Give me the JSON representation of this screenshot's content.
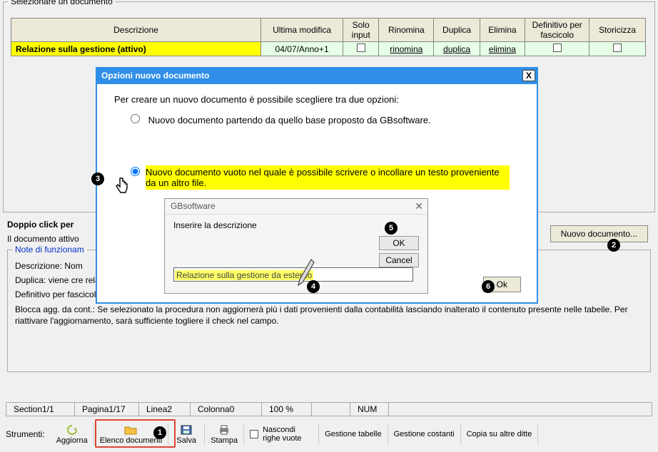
{
  "fieldset_title": "Selezionare un documento",
  "table": {
    "headers": [
      "Descrizione",
      "Ultima modifica",
      "Solo input",
      "Rinomina",
      "Duplica",
      "Elimina",
      "Definitivo per fascicolo",
      "Storicizza"
    ],
    "row": {
      "descrizione": "Relazione sulla gestione (attivo)",
      "ultima_modifica": "04/07/Anno+1",
      "rinomina": "rinomina",
      "duplica": "duplica",
      "elimina": "elimina"
    }
  },
  "below": {
    "line1": "Doppio click per ",
    "line2": "Il documento attivo"
  },
  "new_doc_btn": "Nuovo documento...",
  "notes": {
    "legend": "Note di funzionam",
    "p1": "Descrizione: Nom",
    "p2": "Duplica: viene cre relative ai conti pe",
    "p3": "Definitivo per fascicolo: Selezionare il documento che si ritiene definitivo e che verrà inserito nel fascicolo per la creazione del PDF/A.",
    "p4": "Blocca agg. da cont.: Se selezionato la procedura non aggiornerà più i dati provenienti dalla contabilità lasciando inalterato il contenuto presente nelle tabelle. Per riattivare l'aggiornamento, sarà sufficiente togliere il check nel campo."
  },
  "dlg1": {
    "title": "Opzioni nuovo documento",
    "intro": "Per creare un nuovo documento è possibile scegliere tra due opzioni:",
    "opt1": "Nuovo documento partendo da quello base proposto da GBsoftware.",
    "opt2": "Nuovo documento vuoto nel quale è possibile scrivere o incollare un testo proveniente da un altro file.",
    "ok": "Ok"
  },
  "dlg2": {
    "title": "GBsoftware",
    "label": "Inserire la descrizione",
    "value": "Relazione sulla gestione da esterno",
    "ok": "OK",
    "cancel": "Cancel"
  },
  "status": {
    "section": "Section1/1",
    "pagina": "Pagina1/17",
    "linea": "Linea2",
    "colonna": "Colonna0",
    "zoom": "100 %",
    "num": "NUM"
  },
  "toolbar": {
    "label": "Strumenti:",
    "aggiorna": "Aggiorna",
    "elenco": "Elenco documenti",
    "salva": "Salva",
    "stampa": "Stampa",
    "nascondi": "Nascondi righe vuote",
    "gest_tabelle": "Gestione tabelle",
    "gest_costanti": "Gestione costanti",
    "copia": "Copia su altre ditte"
  }
}
